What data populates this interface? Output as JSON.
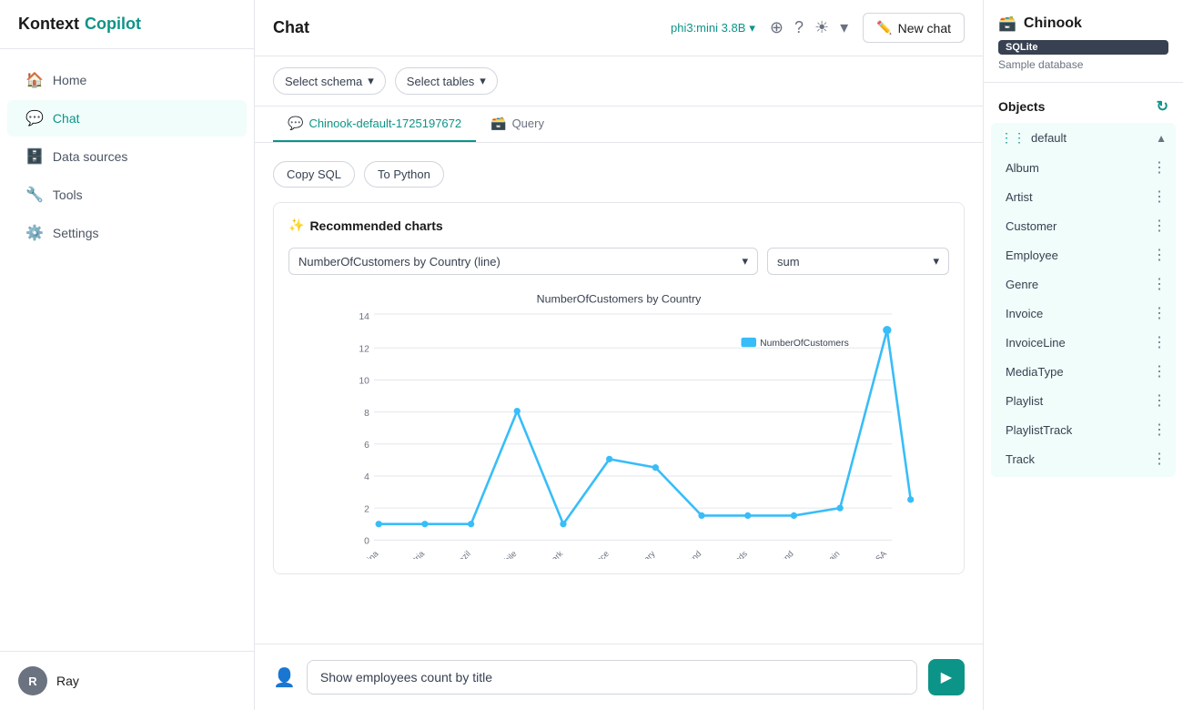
{
  "app": {
    "name_part1": "Kontext",
    "name_part2": "Copilot"
  },
  "sidebar": {
    "nav_items": [
      {
        "id": "home",
        "label": "Home",
        "icon": "🏠",
        "active": false
      },
      {
        "id": "chat",
        "label": "Chat",
        "icon": "💬",
        "active": true
      },
      {
        "id": "data-sources",
        "label": "Data sources",
        "icon": "🗄️",
        "active": false
      },
      {
        "id": "tools",
        "label": "Tools",
        "icon": "🔧",
        "active": false
      },
      {
        "id": "settings",
        "label": "Settings",
        "icon": "⚙️",
        "active": false
      }
    ],
    "user": {
      "name": "Ray",
      "avatar_initials": "R"
    }
  },
  "header": {
    "title": "Chat",
    "model": "phi3:mini 3.8B",
    "new_chat_label": "New chat"
  },
  "toolbar": {
    "select_schema_label": "Select schema",
    "select_tables_label": "Select tables"
  },
  "tabs": [
    {
      "id": "history",
      "label": "Chinook-default-1725197672",
      "icon": "💬",
      "active": true
    },
    {
      "id": "query",
      "label": "Query",
      "icon": "🗃️",
      "active": false
    }
  ],
  "chat": {
    "sql_actions": [
      {
        "id": "copy-sql",
        "label": "Copy SQL"
      },
      {
        "id": "to-python",
        "label": "To Python"
      }
    ],
    "chart_section": {
      "title": "Recommended charts",
      "chart_type_selected": "NumberOfCustomers by Country (line)",
      "aggregation_selected": "sum",
      "chart_title": "NumberOfCustomers by Country",
      "legend_label": "NumberOfCustomers",
      "x_labels": [
        "Argentina",
        "Austria",
        "Brazil",
        "Chile",
        "Denmark",
        "France",
        "Hungary",
        "Ireland",
        "Netherlands",
        "Poland",
        "Spain",
        "USA"
      ],
      "y_values": [
        1,
        1,
        1,
        8,
        1,
        5,
        4.5,
        1.5,
        1.5,
        1.5,
        2,
        13
      ],
      "y_max": 14,
      "y_ticks": [
        0,
        2,
        4,
        6,
        8,
        10,
        12,
        14
      ]
    },
    "input_placeholder": "Show employees count by title",
    "input_value": "Show employees count by title"
  },
  "right_panel": {
    "db_name": "Chinook",
    "db_icon": "🗃️",
    "db_badge": "SQLite",
    "db_description": "Sample database",
    "objects_label": "Objects",
    "schema": {
      "name": "default",
      "tables": [
        {
          "name": "Album"
        },
        {
          "name": "Artist"
        },
        {
          "name": "Customer"
        },
        {
          "name": "Employee"
        },
        {
          "name": "Genre"
        },
        {
          "name": "Invoice"
        },
        {
          "name": "InvoiceLine"
        },
        {
          "name": "MediaType"
        },
        {
          "name": "Playlist"
        },
        {
          "name": "PlaylistTrack"
        },
        {
          "name": "Track"
        }
      ]
    }
  }
}
